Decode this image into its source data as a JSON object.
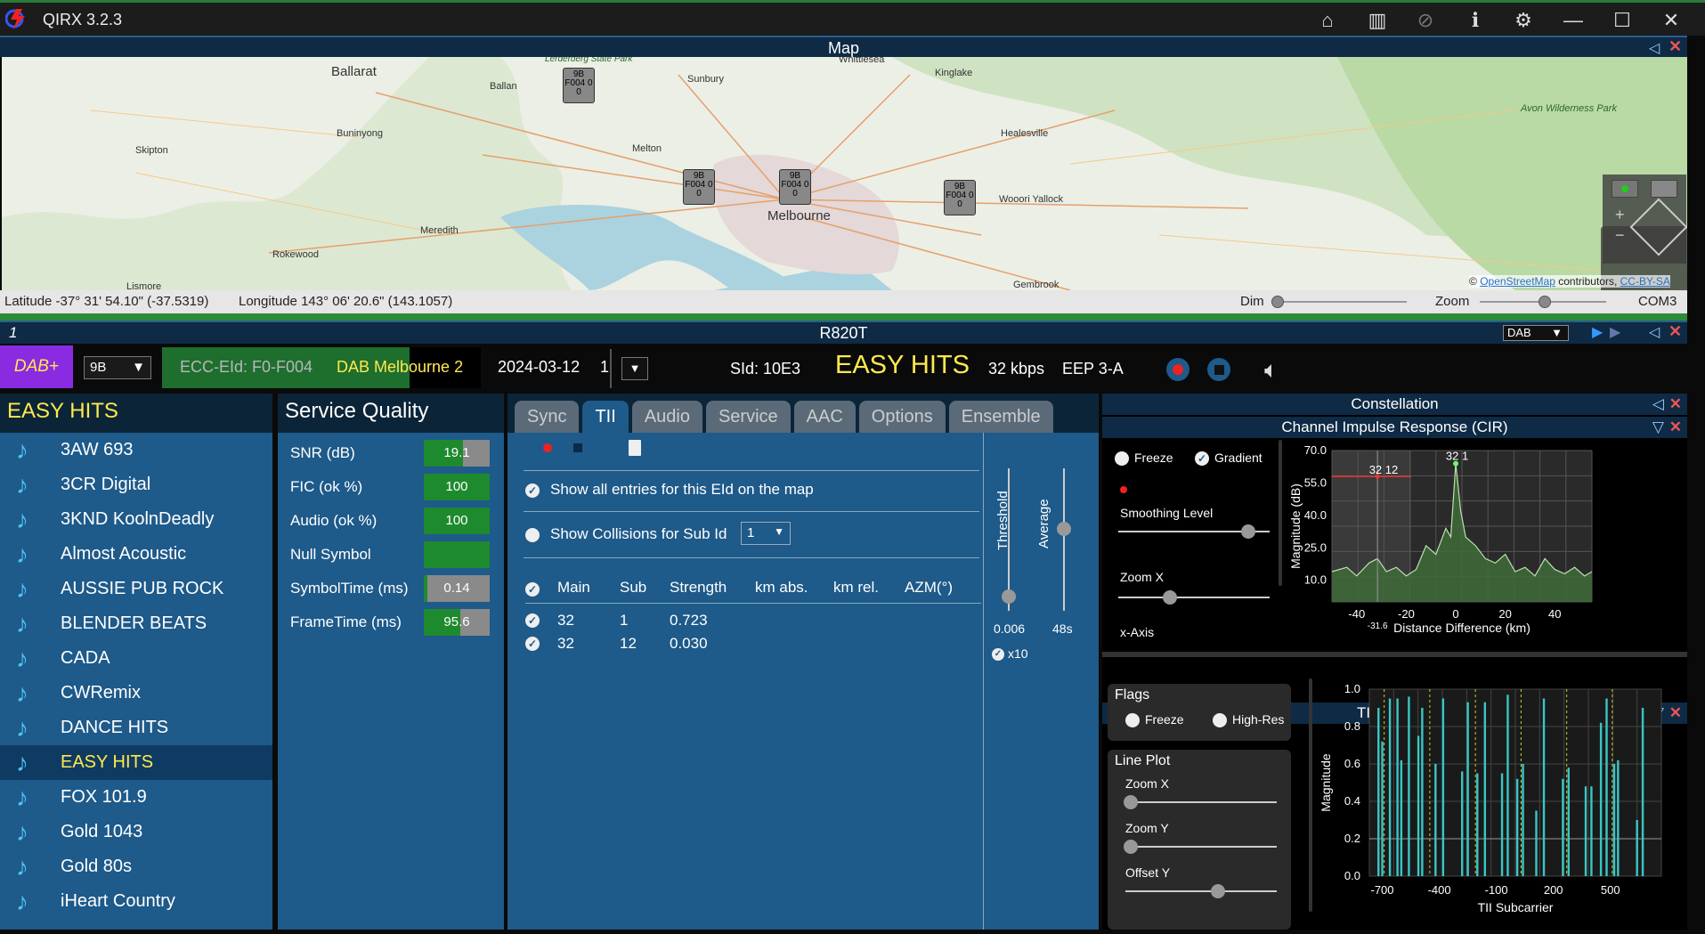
{
  "app": {
    "title": "QIRX 3.2.3"
  },
  "map": {
    "title": "Map",
    "latitude": "Latitude -37° 31' 54.10\" (-37.5319)",
    "longitude": "Longitude 143° 06' 20.6\" (143.1057)",
    "dim_label": "Dim",
    "zoom_label": "Zoom",
    "port": "COM3",
    "attribution_prefix": "©",
    "attribution_link": "OpenStreetMap",
    "attribution_mid": "contributors,",
    "attribution_license": "CC-BY-SA",
    "places": [
      "Ballarat",
      "Ballan",
      "Sunbury",
      "Whittlesea",
      "Kinglake",
      "Healesville",
      "Avon Wilderness Park",
      "Skipton",
      "Buninyong",
      "Melton",
      "Melbourne",
      "Wooori Yallock",
      "Meredith",
      "Rokewood",
      "Lismore",
      "Gembrook",
      "Lerderderg State Park"
    ],
    "markers": [
      "9B F004 0 0",
      "9B F004 0 0",
      "9B F004 0 0",
      "9B F004 0 0"
    ]
  },
  "device": {
    "index": "1",
    "name": "R820T",
    "mode": "DAB"
  },
  "info": {
    "badge": "DAB+",
    "channel": "9B",
    "ecc": "ECC-EId: F0-F004",
    "ensemble": "DAB Melbourne 2",
    "date": "2024-03-12",
    "sid": "SId: 10E3",
    "service": "EASY HITS",
    "bitrate": "32 kbps",
    "eep": "EEP 3-A",
    "date_suffix": "1"
  },
  "services": {
    "header": "EASY HITS",
    "items": [
      "3AW 693",
      "3CR Digital",
      "3KND KoolnDeadly",
      "Almost Acoustic",
      "AUSSIE PUB ROCK",
      "BLENDER BEATS",
      "CADA",
      "CWRemix",
      "DANCE HITS",
      "EASY HITS",
      "FOX 101.9",
      "Gold 1043",
      "Gold 80s",
      "iHeart Country"
    ],
    "selected": 9
  },
  "quality": {
    "header": "Service Quality",
    "rows": [
      {
        "label": "SNR (dB)",
        "value": "19.1",
        "fill": 0.6
      },
      {
        "label": "FIC (ok %)",
        "value": "100",
        "fill": 1
      },
      {
        "label": "Audio (ok %)",
        "value": "100",
        "fill": 1
      },
      {
        "label": "Null Symbol",
        "value": "",
        "fill": 1
      },
      {
        "label": "SymbolTime (ms)",
        "value": "0.14",
        "fill": 0.05
      },
      {
        "label": "FrameTime (ms)",
        "value": "95.6",
        "fill": 0.55
      }
    ]
  },
  "tabs": [
    "Sync",
    "TII",
    "Audio",
    "Service",
    "AAC",
    "Options",
    "Ensemble"
  ],
  "tii": {
    "show_all": "Show all entries for this EId on the map",
    "show_collisions": "Show Collisions for Sub Id",
    "sub_id": "1",
    "columns": [
      "Main",
      "Sub",
      "Strength",
      "km abs.",
      "km rel.",
      "AZM(°)"
    ],
    "rows": [
      [
        "32",
        "1",
        "0.723",
        "",
        "",
        ""
      ],
      [
        "32",
        "12",
        "0.030",
        "",
        "",
        ""
      ]
    ],
    "threshold_label": "Threshold",
    "average_label": "Average",
    "threshold_value": "0.006",
    "average_value": "48s",
    "x10": "x10"
  },
  "constellation": {
    "title": "Constellation"
  },
  "cir": {
    "title": "Channel Impulse Response (CIR)",
    "freeze": "Freeze",
    "gradient": "Gradient",
    "smoothing": "Smoothing Level",
    "zoomx": "Zoom X",
    "xaxis": "x-Axis",
    "ylabel": "Magnitude (dB)",
    "xlabel": "Distance Difference (km)",
    "yticks": [
      "70.0",
      "55.0",
      "40.0",
      "25.0",
      "10.0"
    ],
    "xticks": [
      "-40",
      "-20",
      "0",
      "20",
      "40"
    ],
    "peak1": "32 12",
    "peak2": "32 1",
    "marker": "-31.6"
  },
  "carriers": {
    "title": "TII Carriers",
    "flags": "Flags",
    "freeze": "Freeze",
    "highres": "High-Res",
    "lineplot": "Line Plot",
    "zoomx": "Zoom X",
    "zoomy": "Zoom Y",
    "offsety": "Offset Y",
    "ylabel": "Magnitude",
    "xlabel": "TII Subcarrier",
    "yticks": [
      "1.0",
      "0.8",
      "0.6",
      "0.4",
      "0.2",
      "0.0"
    ],
    "xticks": [
      "-700",
      "-400",
      "-100",
      "200",
      "500"
    ]
  },
  "chart_data": [
    {
      "type": "area",
      "title": "Channel Impulse Response (CIR)",
      "xlabel": "Distance Difference (km)",
      "ylabel": "Magnitude (dB)",
      "ylim": [
        0,
        70
      ],
      "xlim": [
        -50,
        55
      ],
      "x": [
        -50,
        -44,
        -40,
        -35,
        -31.6,
        -28,
        -24,
        -20,
        -16,
        -12,
        -8,
        -4,
        -2,
        0,
        2,
        4,
        8,
        12,
        16,
        20,
        24,
        28,
        32,
        36,
        40,
        44,
        48,
        52,
        55
      ],
      "y": [
        14,
        16,
        12,
        18,
        20,
        14,
        16,
        12,
        15,
        26,
        22,
        34,
        30,
        64,
        42,
        30,
        26,
        20,
        18,
        22,
        14,
        16,
        12,
        20,
        15,
        13,
        16,
        12,
        14
      ]
    },
    {
      "type": "bar",
      "title": "TII Carriers",
      "xlabel": "TII Subcarrier",
      "ylabel": "Magnitude",
      "ylim": [
        0,
        1
      ],
      "xlim": [
        -768,
        768
      ],
      "x": [
        -720,
        -700,
        -660,
        -620,
        -600,
        -560,
        -510,
        -490,
        -420,
        -380,
        -280,
        -250,
        -200,
        -160,
        -70,
        -40,
        10,
        40,
        110,
        150,
        250,
        280,
        370,
        400,
        450,
        480,
        520,
        540,
        640,
        670
      ],
      "y": [
        0.9,
        0.72,
        0.95,
        0.95,
        0.62,
        0.96,
        0.75,
        0.9,
        0.6,
        0.95,
        0.56,
        0.93,
        0.55,
        0.93,
        0.55,
        0.97,
        0.52,
        0.6,
        0.35,
        0.95,
        0.52,
        0.58,
        0.48,
        0.48,
        0.82,
        0.95,
        0.6,
        0.62,
        0.3,
        0.9
      ]
    }
  ]
}
